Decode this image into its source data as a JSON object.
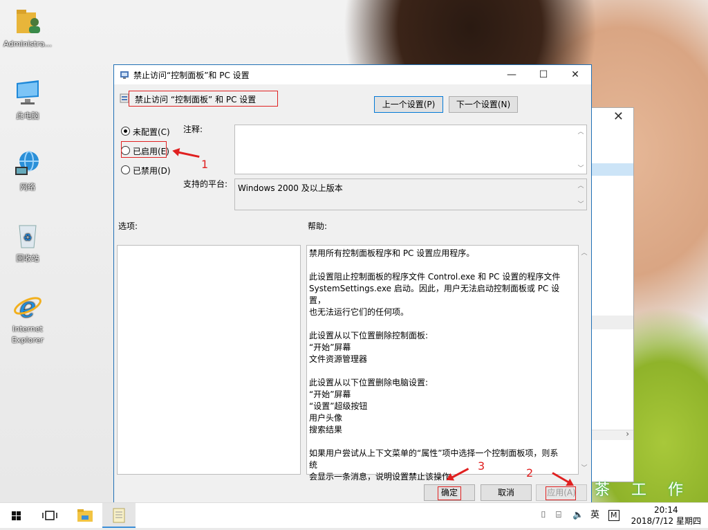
{
  "desktop": {
    "icons": [
      {
        "label": "Administra..."
      },
      {
        "label": "此电脑"
      },
      {
        "label": "网络"
      },
      {
        "label": "回收站"
      },
      {
        "label": "Internet Explorer"
      }
    ],
    "watermark": "茶 工 作 室"
  },
  "dialog": {
    "title": "禁止访问“控制面板”和 PC 设置",
    "setting_name": "禁止访问 “控制面板” 和 PC 设置",
    "prev_button": "上一个设置(P)",
    "next_button": "下一个设置(N)",
    "radios": [
      {
        "label": "未配置(C)",
        "checked": true
      },
      {
        "label": "已启用(E)",
        "checked": false
      },
      {
        "label": "已禁用(D)",
        "checked": false
      }
    ],
    "comment_label": "注释:",
    "comment_value": "",
    "platform_label": "支持的平台:",
    "platform_value": "Windows 2000 及以上版本",
    "options_label": "选项:",
    "help_label": "帮助:",
    "help_paragraphs": [
      [
        "禁用所有控制面板程序和 PC 设置应用程序。"
      ],
      [
        "此设置阻止控制面板的程序文件 Control.exe 和 PC 设置的程序文件",
        "SystemSettings.exe 启动。因此，用户无法启动控制面板或 PC 设置，",
        "也无法运行它们的任何项。"
      ],
      [
        "此设置从以下位置删除控制面板:",
        "“开始”屏幕",
        "文件资源管理器"
      ],
      [
        "此设置从以下位置删除电脑设置:",
        "“开始”屏幕",
        "“设置”超级按钮",
        "用户头像",
        "搜索结果"
      ],
      [
        "如果用户尝试从上下文菜单的“属性”项中选择一个控制面板项，则系统",
        "会显示一条消息，说明设置禁止该操作。"
      ]
    ],
    "ok_button": "确定",
    "cancel_button": "取消",
    "apply_button": "应用(A)"
  },
  "annotations": {
    "one": "1",
    "two": "2",
    "three": "3",
    "color": "#e02020"
  },
  "taskbar": {
    "ime": "英",
    "time": "20:14",
    "date": "2018/7/12 星期四"
  }
}
